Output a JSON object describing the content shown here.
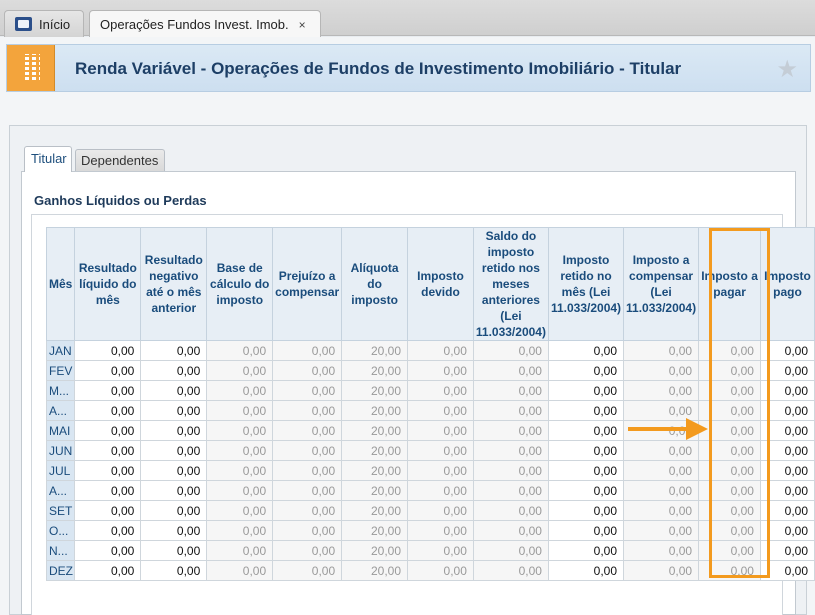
{
  "tabs": {
    "home_label": "Início",
    "ops_label": "Operações Fundos Invest. Imob.",
    "close_glyph": "×"
  },
  "header": {
    "title": "Renda Variável - Operações de Fundos de Investimento Imobiliário - Titular",
    "icon": "building-icon",
    "favorite_glyph": "★"
  },
  "subtabs": {
    "titular": "Titular",
    "dependentes": "Dependentes"
  },
  "section_title": "Ganhos Líquidos ou Perdas",
  "columns": [
    {
      "label": "Mês",
      "editable": false
    },
    {
      "label": "Resultado líquido do mês",
      "editable": true
    },
    {
      "label": "Resultado negativo até o mês anterior",
      "editable": true
    },
    {
      "label": "Base de cálculo do imposto",
      "editable": false
    },
    {
      "label": "Prejuízo a compensar",
      "editable": false
    },
    {
      "label": "Alíquota do imposto",
      "editable": false
    },
    {
      "label": "Imposto devido",
      "editable": false
    },
    {
      "label": "Saldo do imposto retido nos meses anteriores (Lei 11.033/2004)",
      "editable": false
    },
    {
      "label": "Imposto retido no mês (Lei 11.033/2004)",
      "editable": true
    },
    {
      "label": "Imposto a compensar (Lei 11.033/2004)",
      "editable": false
    },
    {
      "label": "Imposto a pagar",
      "editable": false
    },
    {
      "label": "Imposto pago",
      "editable": true
    }
  ],
  "rows": [
    {
      "month": "JAN",
      "values": [
        "0,00",
        "0,00",
        "0,00",
        "0,00",
        "20,00",
        "0,00",
        "0,00",
        "0,00",
        "0,00",
        "0,00",
        "0,00"
      ]
    },
    {
      "month": "FEV",
      "values": [
        "0,00",
        "0,00",
        "0,00",
        "0,00",
        "20,00",
        "0,00",
        "0,00",
        "0,00",
        "0,00",
        "0,00",
        "0,00"
      ]
    },
    {
      "month": "MAR",
      "values": [
        "0,00",
        "0,00",
        "0,00",
        "0,00",
        "20,00",
        "0,00",
        "0,00",
        "0,00",
        "0,00",
        "0,00",
        "0,00"
      ]
    },
    {
      "month": "ABR",
      "values": [
        "0,00",
        "0,00",
        "0,00",
        "0,00",
        "20,00",
        "0,00",
        "0,00",
        "0,00",
        "0,00",
        "0,00",
        "0,00"
      ]
    },
    {
      "month": "MAI",
      "values": [
        "0,00",
        "0,00",
        "0,00",
        "0,00",
        "20,00",
        "0,00",
        "0,00",
        "0,00",
        "0,00",
        "0,00",
        "0,00"
      ]
    },
    {
      "month": "JUN",
      "values": [
        "0,00",
        "0,00",
        "0,00",
        "0,00",
        "20,00",
        "0,00",
        "0,00",
        "0,00",
        "0,00",
        "0,00",
        "0,00"
      ]
    },
    {
      "month": "JUL",
      "values": [
        "0,00",
        "0,00",
        "0,00",
        "0,00",
        "20,00",
        "0,00",
        "0,00",
        "0,00",
        "0,00",
        "0,00",
        "0,00"
      ]
    },
    {
      "month": "AGO",
      "values": [
        "0,00",
        "0,00",
        "0,00",
        "0,00",
        "20,00",
        "0,00",
        "0,00",
        "0,00",
        "0,00",
        "0,00",
        "0,00"
      ]
    },
    {
      "month": "SET",
      "values": [
        "0,00",
        "0,00",
        "0,00",
        "0,00",
        "20,00",
        "0,00",
        "0,00",
        "0,00",
        "0,00",
        "0,00",
        "0,00"
      ]
    },
    {
      "month": "OUT",
      "values": [
        "0,00",
        "0,00",
        "0,00",
        "0,00",
        "20,00",
        "0,00",
        "0,00",
        "0,00",
        "0,00",
        "0,00",
        "0,00"
      ]
    },
    {
      "month": "NOV",
      "values": [
        "0,00",
        "0,00",
        "0,00",
        "0,00",
        "20,00",
        "0,00",
        "0,00",
        "0,00",
        "0,00",
        "0,00",
        "0,00"
      ]
    },
    {
      "month": "DEZ",
      "values": [
        "0,00",
        "0,00",
        "0,00",
        "0,00",
        "20,00",
        "0,00",
        "0,00",
        "0,00",
        "0,00",
        "0,00",
        "0,00"
      ]
    }
  ],
  "month_display": [
    "JAN",
    "FEV",
    "M...",
    "A...",
    "MAI",
    "JUN",
    "JUL",
    "A...",
    "SET",
    "O...",
    "N...",
    "DEZ"
  ],
  "colors": {
    "accent": "#f39a1e",
    "header_text": "#1d3f66",
    "column_header_bg": "#e7eef5"
  }
}
